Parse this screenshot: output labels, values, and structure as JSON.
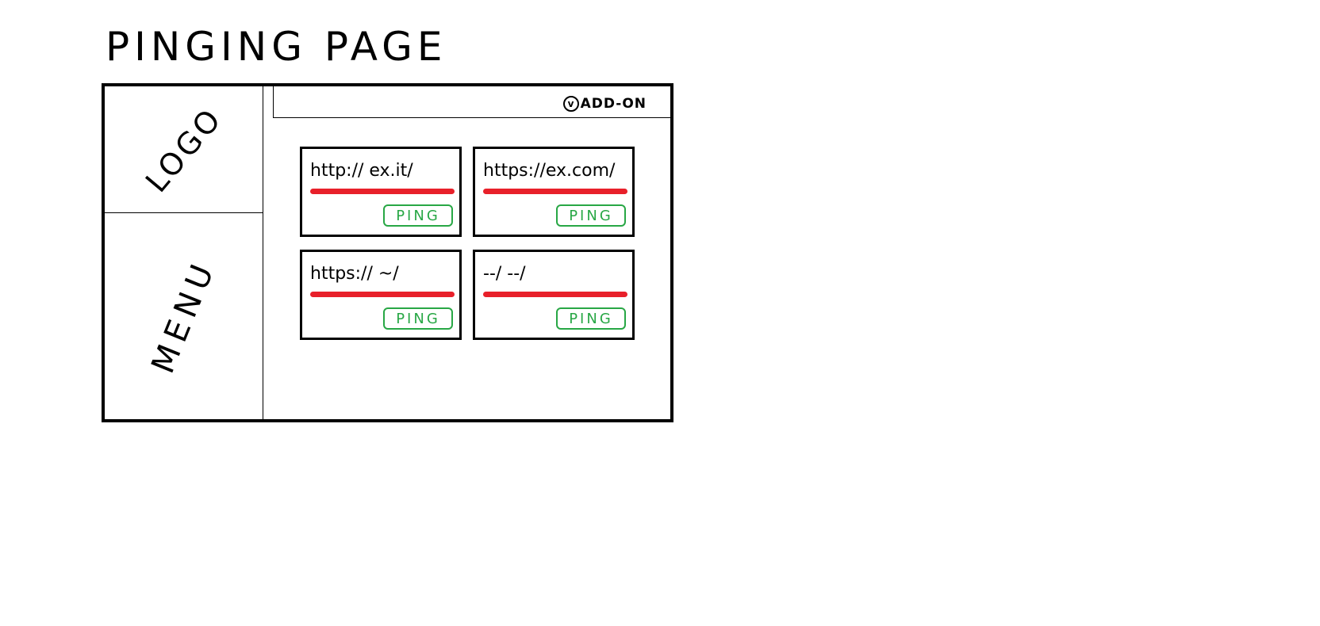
{
  "page": {
    "title": "PINGING PAGE"
  },
  "sidebar": {
    "logo_label": "LOGO",
    "menu_label": "MENU"
  },
  "topbar": {
    "addon_icon": "v",
    "addon_label": "ADD-ON"
  },
  "cards": [
    {
      "url": "http:// ex.it/",
      "button_label": "PING"
    },
    {
      "url": "https://ex.com/",
      "button_label": "PING"
    },
    {
      "url": "https:// ~/",
      "button_label": "PING"
    },
    {
      "url": "--/ --/",
      "button_label": "PING"
    }
  ],
  "colors": {
    "accent_underline": "#e8202a",
    "ping_button": "#28a745"
  }
}
